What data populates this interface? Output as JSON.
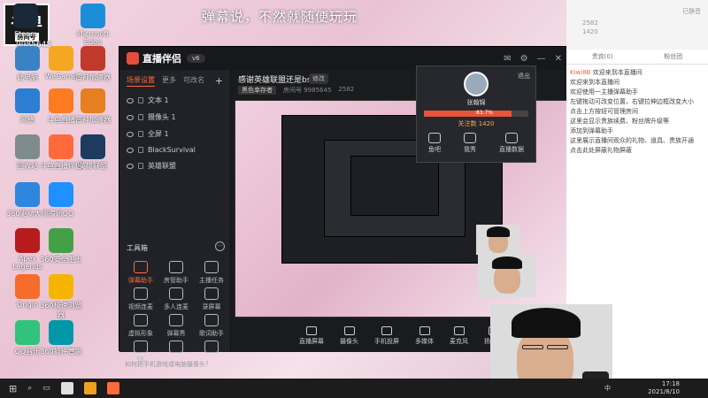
{
  "overlay": {
    "brand": "斗鱼",
    "brand_sub": "房间号",
    "room_number": "9985645",
    "danmu": "弹幕说，不然就随便玩玩"
  },
  "desktop_icons": [
    {
      "label": "Administr...",
      "color": "#3a7bd5"
    },
    {
      "label": "Steam",
      "color": "#1b2838"
    },
    {
      "label": "Microsoft Edge",
      "color": "#1a8fd8"
    },
    {
      "label": "此电脑",
      "color": "#3b82c4"
    },
    {
      "label": "WeGame",
      "color": "#f5a623"
    },
    {
      "label": "雷神加速器",
      "color": "#c0392b"
    },
    {
      "label": "网络",
      "color": "#2d7dd2"
    },
    {
      "label": "斗鱼直播",
      "color": "#ff7a21"
    },
    {
      "label": "雷神加速器",
      "color": "#e67e22"
    },
    {
      "label": "回收站",
      "color": "#7f8c8d"
    },
    {
      "label": "斗鱼直播伴侣",
      "color": "#ff6a3c"
    },
    {
      "label": "英雄联盟",
      "color": "#1e3a5f"
    },
    {
      "label": "360驱动大师",
      "color": "#2e86de"
    },
    {
      "label": "腾讯QQ",
      "color": "#1e90ff"
    },
    {
      "label": "Apex Legends",
      "color": "#b71c1c"
    },
    {
      "label": "360安全卫士",
      "color": "#43a047"
    },
    {
      "label": "Origin",
      "color": "#f56c2d"
    },
    {
      "label": "360极速浏览器",
      "color": "#f4b400"
    },
    {
      "label": "QQ音乐",
      "color": "#31c27c"
    },
    {
      "label": "360软件管家",
      "color": "#0097a7"
    }
  ],
  "app": {
    "logo": "直播伴侣",
    "version": "v6",
    "tabs": [
      "场景设置",
      "更多",
      "可改名"
    ],
    "sources": [
      "文本 1",
      "摄像头 1",
      "全屏 1",
      "BlackSurvival",
      "英雄联盟"
    ],
    "tools_title": "工具箱",
    "tools": [
      "弹幕助手",
      "房管助手",
      "主播任务",
      "视频连麦",
      "多人连麦",
      "录屏幕",
      "虚拟形象",
      "弹幕秀",
      "歌词助手",
      "PK",
      "",
      ""
    ],
    "help": "如何把手机游戏或电脑摄像头？",
    "room_title": "感谢英雄联盟还是bs?",
    "edit_label": "修改",
    "category": "黑色幸存者",
    "room_id": "房间号 9985645",
    "popularity": "2582",
    "bottom_actions": [
      "直播屏幕",
      "摄像头",
      "手机投屏",
      "多媒体",
      "麦克风",
      "扬声器"
    ]
  },
  "popup": {
    "name": "张翰锦",
    "level_percent": "83.7%",
    "follow": "关注数 1420",
    "exit": "退出",
    "actions": [
      "鱼吧",
      "我秀",
      "直播数据"
    ]
  },
  "right_panel": {
    "top_stats": [
      "2582",
      "1420"
    ],
    "status": "已静音",
    "tabs": [
      "贵宾(0)",
      "粉丝团"
    ],
    "chat": [
      {
        "user": "Kiwi8B",
        "text": "欢迎来到本直播间"
      },
      {
        "user": "",
        "text": "欢迎来到本直播间"
      },
      {
        "user": "",
        "text": "欢迎使用一主播弹幕助手"
      },
      {
        "user": "",
        "text": "左键拖动可改变位置，右键拉伸边框改变大小"
      },
      {
        "user": "",
        "text": "点击上方按钮可管理房间"
      },
      {
        "user": "",
        "text": "这里会显示贵族续费、粉丝牌升级等"
      },
      {
        "user": "",
        "text": "添加到弹幕助手"
      },
      {
        "user": "",
        "text": "这里展示直播间观众的礼物、道具、贵族开通"
      },
      {
        "user": "",
        "text": "点击此处屏蔽礼物屏蔽"
      }
    ]
  },
  "taskbar": {
    "time": "17:18",
    "date": "2021/8/10",
    "lang": "中"
  }
}
